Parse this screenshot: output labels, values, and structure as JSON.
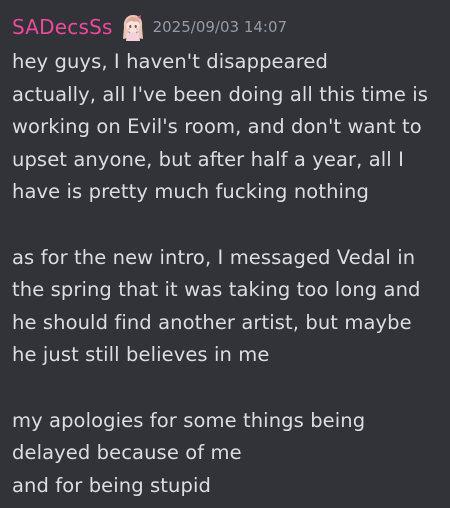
{
  "message": {
    "author": "SADecsSs",
    "timestamp": "2025/09/03 14:07",
    "role_icon": "anime-girl-avatar-icon",
    "colors": {
      "username": "#f0489a",
      "timestamp": "#949ba4",
      "text": "#dbdee1",
      "background": "#323339"
    },
    "lines": [
      "hey guys, I haven't disappeared",
      "actually, all I've been doing all this time is",
      "working on Evil's room, and don't want to",
      "upset anyone, but after half a year, all I",
      "have is pretty much fucking nothing",
      "",
      "as for the new intro, I messaged Vedal in",
      "the spring that it was taking too long and",
      "he should find another artist, but maybe",
      "he just still believes in me",
      "",
      "my apologies for some things being",
      "delayed because of me",
      "and for being stupid"
    ]
  }
}
